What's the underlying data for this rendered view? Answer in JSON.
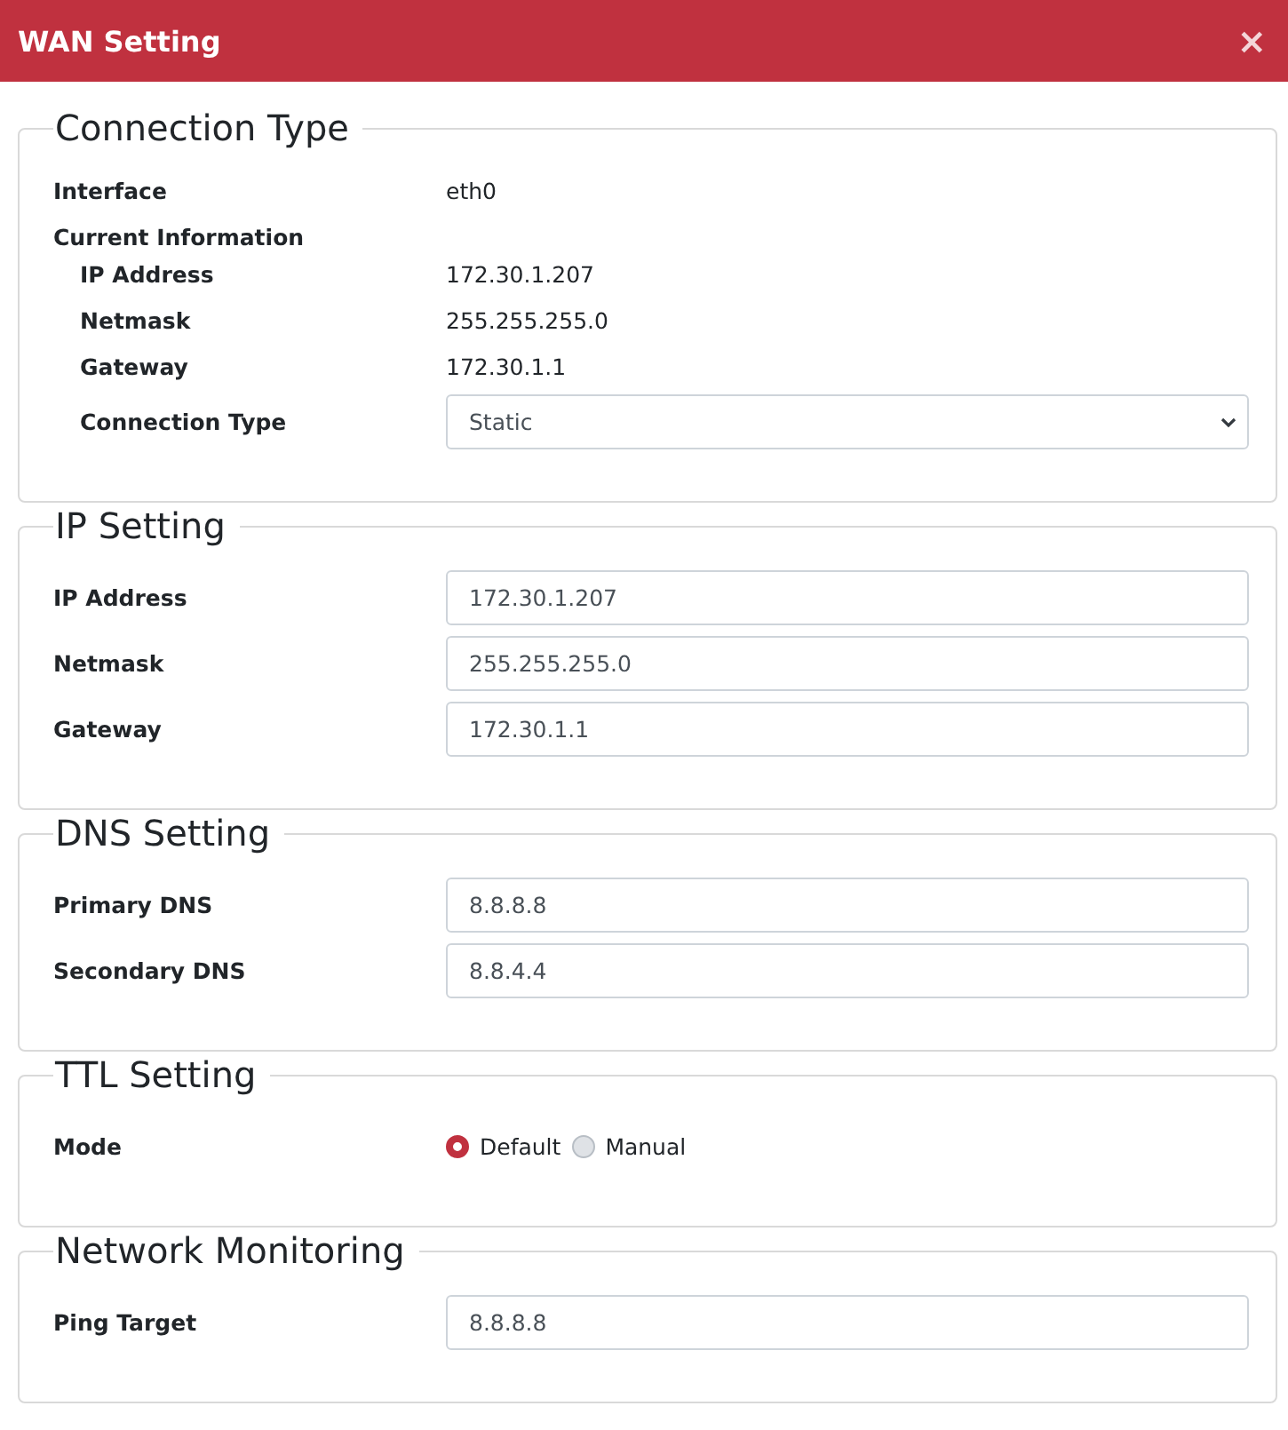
{
  "dialog": {
    "title": "WAN Setting",
    "close": "×"
  },
  "sections": [
    {
      "title": "Connection Type",
      "rows": [
        {
          "kind": "text",
          "label": "Interface",
          "value": "eth0"
        },
        {
          "kind": "group",
          "label": "Current Information",
          "children": [
            {
              "kind": "text",
              "label": "IP Address",
              "value": "172.30.1.207"
            },
            {
              "kind": "text",
              "label": "Netmask",
              "value": "255.255.255.0"
            },
            {
              "kind": "text",
              "label": "Gateway",
              "value": "172.30.1.1"
            },
            {
              "kind": "select",
              "label": "Connection Type",
              "value": "Static"
            }
          ]
        }
      ]
    },
    {
      "title": "IP Setting",
      "rows": [
        {
          "kind": "input",
          "label": "IP Address",
          "value": "172.30.1.207"
        },
        {
          "kind": "input",
          "label": "Netmask",
          "value": "255.255.255.0"
        },
        {
          "kind": "input",
          "label": "Gateway",
          "value": "172.30.1.1"
        }
      ]
    },
    {
      "title": "DNS Setting",
      "rows": [
        {
          "kind": "input",
          "label": "Primary DNS",
          "value": "8.8.8.8"
        },
        {
          "kind": "input",
          "label": "Secondary DNS",
          "value": "8.8.4.4"
        }
      ]
    },
    {
      "title": "TTL Setting",
      "rows": [
        {
          "kind": "radio",
          "label": "Mode",
          "options": [
            {
              "label": "Default",
              "selected": true
            },
            {
              "label": "Manual",
              "selected": false
            }
          ]
        }
      ]
    },
    {
      "title": "Network Monitoring",
      "rows": [
        {
          "kind": "input",
          "label": "Ping Target",
          "value": "8.8.8.8"
        }
      ]
    }
  ]
}
